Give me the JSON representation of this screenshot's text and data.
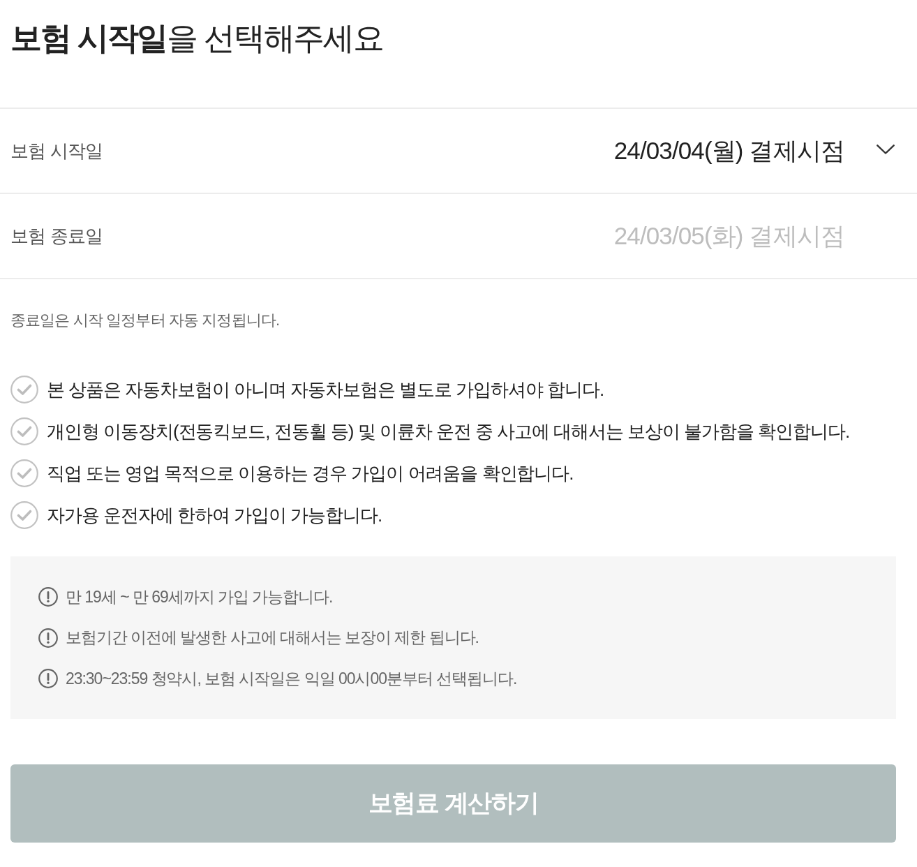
{
  "title": "**보험 시작일**을 선택해주세요",
  "date_fields": [
    {
      "label": "보험 시작일",
      "value": "24/03/04(월) 결제시점",
      "kind": "dropdown",
      "disabled": false
    },
    {
      "label": "보험 종료일",
      "value": "24/03/05(화) 결제시점",
      "kind": "static",
      "disabled": true
    }
  ],
  "note": "종료일은 시작 일정부터 자동 지정됩니다.",
  "agreements": [
    {
      "text": "본 상품은 자동차보험이 아니며 자동차보험은 별도로 가입하셔야 합니다.",
      "checked": false
    },
    {
      "text": "개인형 이동장치(전동킥보드, 전동휠 등) 및 이륜차 운전 중 사고에 대해서는 보상이 불가함을 확인합니다.",
      "checked": false
    },
    {
      "text": "직업 또는 영업 목적으로 이용하는 경우 가입이 어려움을 확인합니다.",
      "checked": false
    },
    {
      "text": "자가용 운전자에 한하여 가입이 가능합니다.",
      "checked": false
    }
  ],
  "notices": [
    "만 19세 ~ 만 69세까지 가입 가능합니다.",
    "보험기간 이전에 발생한 사고에 대해서는 보장이 제한 됩니다.",
    "23:30~23:59 청약시, 보험 시작일은 익일 00시00분부터 선택됩니다."
  ],
  "submit_button": {
    "label": "보험료 계산하기",
    "disabled": true
  }
}
